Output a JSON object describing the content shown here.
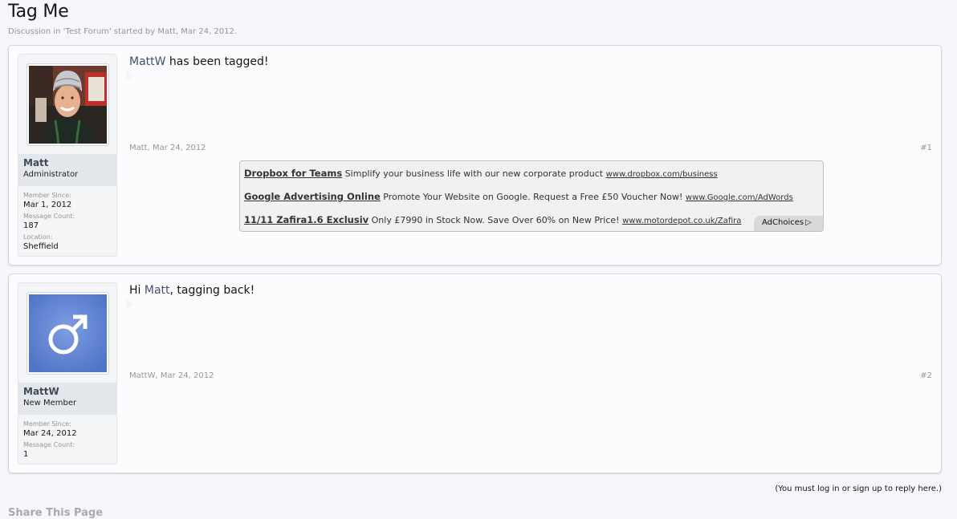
{
  "thread": {
    "title": "Tag Me",
    "desc_prefix": "Discussion in '",
    "forum": "Test Forum",
    "desc_mid": "' started by ",
    "starter": "Matt",
    "desc_sep": ", ",
    "date": "Mar 24, 2012",
    "desc_end": "."
  },
  "posts": [
    {
      "username": "Matt",
      "user_title": "Administrator",
      "avatar_icon": "user-photo-icon",
      "stats": [
        {
          "label": "Member Since:",
          "value": "Mar 1, 2012"
        },
        {
          "label": "Message Count:",
          "value": "187"
        },
        {
          "label": "Location:",
          "value": "Sheffield"
        }
      ],
      "text_mention": "MattW",
      "text_rest": " has been tagged!",
      "meta_author": "Matt",
      "meta_sep": ", ",
      "meta_date": "Mar 24, 2012",
      "number": "#1"
    },
    {
      "username": "MattW",
      "user_title": "New Member",
      "avatar_icon": "male-symbol-icon",
      "stats": [
        {
          "label": "Member Since:",
          "value": "Mar 24, 2012"
        },
        {
          "label": "Message Count:",
          "value": "1"
        }
      ],
      "text_prefix": "Hi ",
      "text_mention": "Matt",
      "text_rest": ", tagging back!",
      "meta_author": "MattW",
      "meta_sep": ", ",
      "meta_date": "Mar 24, 2012",
      "number": "#2"
    }
  ],
  "ads": [
    {
      "title": "Dropbox for Teams",
      "text": " Simplify your business life with our new corporate product ",
      "url": "www.dropbox.com/business"
    },
    {
      "title": "Google Advertising Online",
      "text": " Promote Your Website on Google. Request a Free £50 Voucher Now! ",
      "url": "www.Google.com/AdWords"
    },
    {
      "title": "11/11 Zafira1.6 Exclusiv",
      "text": " Only £7990 in Stock Now. Save Over 60% on New Price! ",
      "url": "www.motordepot.co.uk/Zafira"
    }
  ],
  "adchoices": {
    "label": "AdChoices",
    "icon": "adchoices-triangle-icon"
  },
  "footer": {
    "login_note": "(You must log in or sign up to reply here.)",
    "share_heading": "Share This Page"
  },
  "colors": {
    "background": "#f6f7fb",
    "message_bg": "#fcfcff",
    "link": "#3e4f76",
    "muted": "#969696",
    "male_avatar": "#5b7fd1"
  }
}
